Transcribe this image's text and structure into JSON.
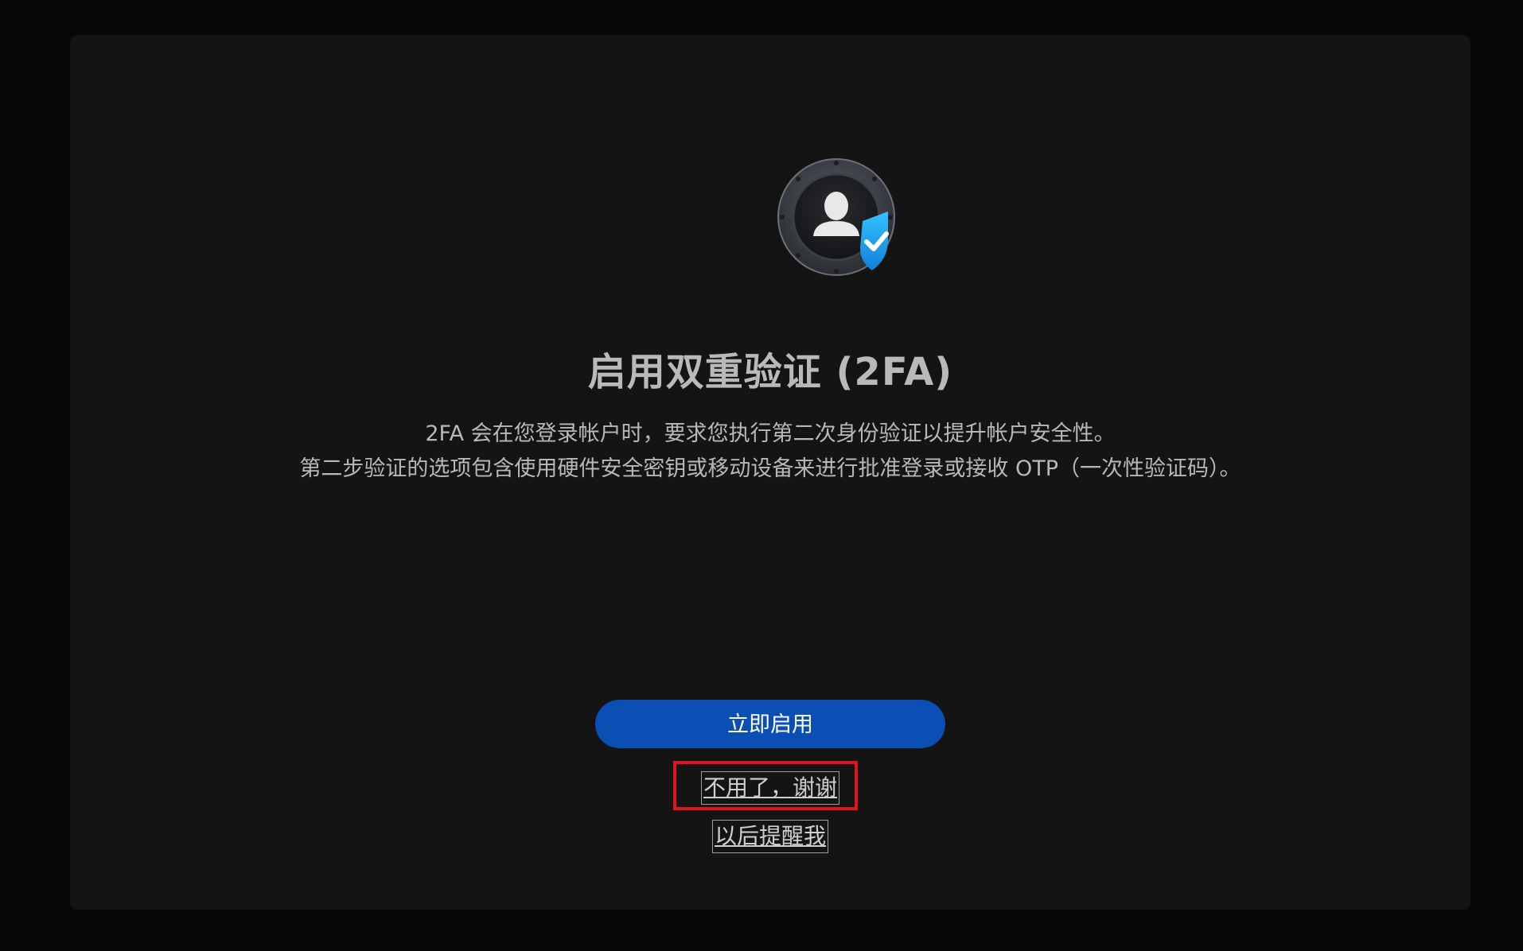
{
  "dialog": {
    "title": "启用双重验证 (2FA)",
    "description_line1": "2FA 会在您登录帐户时，要求您执行第二次身份验证以提升帐户安全性。",
    "description_line2": "第二步验证的选项包含使用硬件安全密钥或移动设备来进行批准登录或接收 OTP（一次性验证码）。",
    "icon": "user-shield-check-icon",
    "actions": {
      "enable_label": "立即启用",
      "no_thanks_label": "不用了，谢谢",
      "remind_later_label": "以后提醒我"
    }
  },
  "colors": {
    "background": "#080809",
    "panel": "#141415",
    "primary_button": "#0b4fb4",
    "shield": "#1ea6ea",
    "highlight": "#e0141e"
  }
}
